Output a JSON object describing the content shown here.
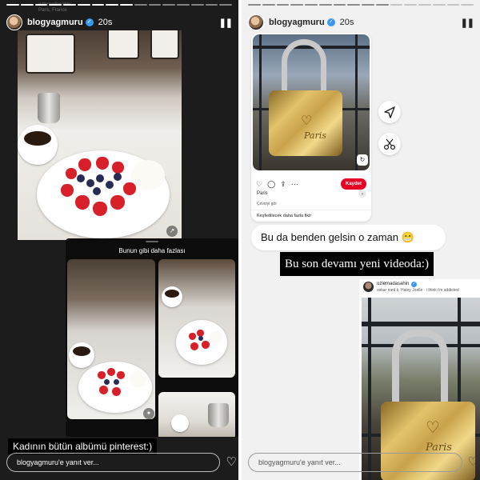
{
  "left_story": {
    "ghost_user": "ozlemadasahin",
    "ghost_location": "Paris, France",
    "username": "blogyagmuru",
    "time": "20s",
    "more_like_this": "Bunun gibi daha fazlası",
    "caption": "Kadının bütün albümü pinterest:)",
    "reply_placeholder": "blogyagmuru'e yanıt ver...",
    "pause_icon": "pause-icon",
    "heart_icon": "heart-icon"
  },
  "right_story": {
    "username": "blogyagmuru",
    "time": "20s",
    "pin": {
      "save_label": "Kaydet",
      "board": "Paris",
      "translate": "Çeviriyi gör",
      "more_ideas": "Keşfedilecek daha fazla fikir",
      "lock_text": "Paris"
    },
    "message": "Bu da benden gelsin o zaman 😁",
    "caption": "Bu son devamı yeni videoda:)",
    "shared_post": {
      "username": "ozlemadasahin",
      "music": "oskar med k, Haley Joelle · i think i'm addicted"
    },
    "reply_placeholder": "blogyagmuru'e yanıt ver..."
  },
  "colors": {
    "pinterest_red": "#e60023",
    "verified_blue": "#3897f0"
  }
}
